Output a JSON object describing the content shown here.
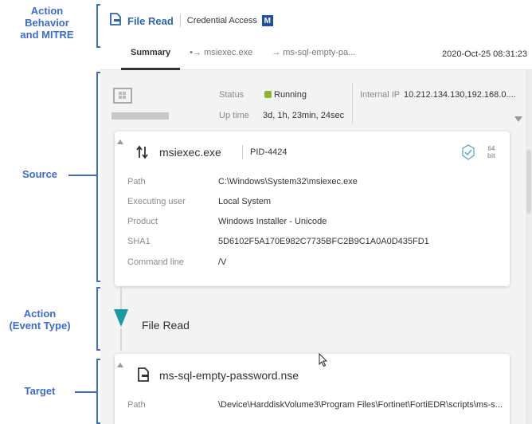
{
  "annotations": {
    "behavior": "Action\nBehavior\nand MITRE",
    "source": "Source",
    "action": "Action\n(Event Type)",
    "target": "Target"
  },
  "header": {
    "title": "File Read",
    "tactic": "Credential Access",
    "mitre_badge": "M",
    "timestamp": "2020-Oct-25 08:31:23"
  },
  "tabs": [
    {
      "label": "Summary",
      "active": true
    },
    {
      "label": "msiexec.exe",
      "icon": "process-arrow-icon"
    },
    {
      "label": "ms-sql-empty-pa...",
      "icon": "process-arrow-icon"
    }
  ],
  "host": {
    "status_label": "Status",
    "status_value": "Running",
    "uptime_label": "Up time",
    "uptime_value": "3d, 1h, 23min, 24sec",
    "ip_label": "Internal IP",
    "ip_value": "10.212.134.130,192.168.0...."
  },
  "source": {
    "process": "msiexec.exe",
    "pid": "PID-4424",
    "bitness_num": "64",
    "bitness_unit": "bit",
    "fields": [
      {
        "label": "Path",
        "value": "C:\\Windows\\System32\\msiexec.exe"
      },
      {
        "label": "Executing user",
        "value": "Local System"
      },
      {
        "label": "Product",
        "value": "Windows Installer - Unicode"
      },
      {
        "label": "SHA1",
        "value": "5D6102F5A170E982C7735BFC2B9C1A0A0D435FD1"
      },
      {
        "label": "Command line",
        "value": "/V"
      }
    ]
  },
  "action": {
    "label": "File Read",
    "color": "#1a9ba1"
  },
  "target": {
    "file": "ms-sql-empty-password.nse",
    "path_label": "Path",
    "path_value": "\\Device\\HarddiskVolume3\\Program Files\\Fortinet\\FortiEDR\\scripts\\ms-s..."
  },
  "colors": {
    "annotation": "#3d6bd1",
    "title": "#2f63b5",
    "running": "#8ab630",
    "mitre": "#1d4fa3"
  }
}
